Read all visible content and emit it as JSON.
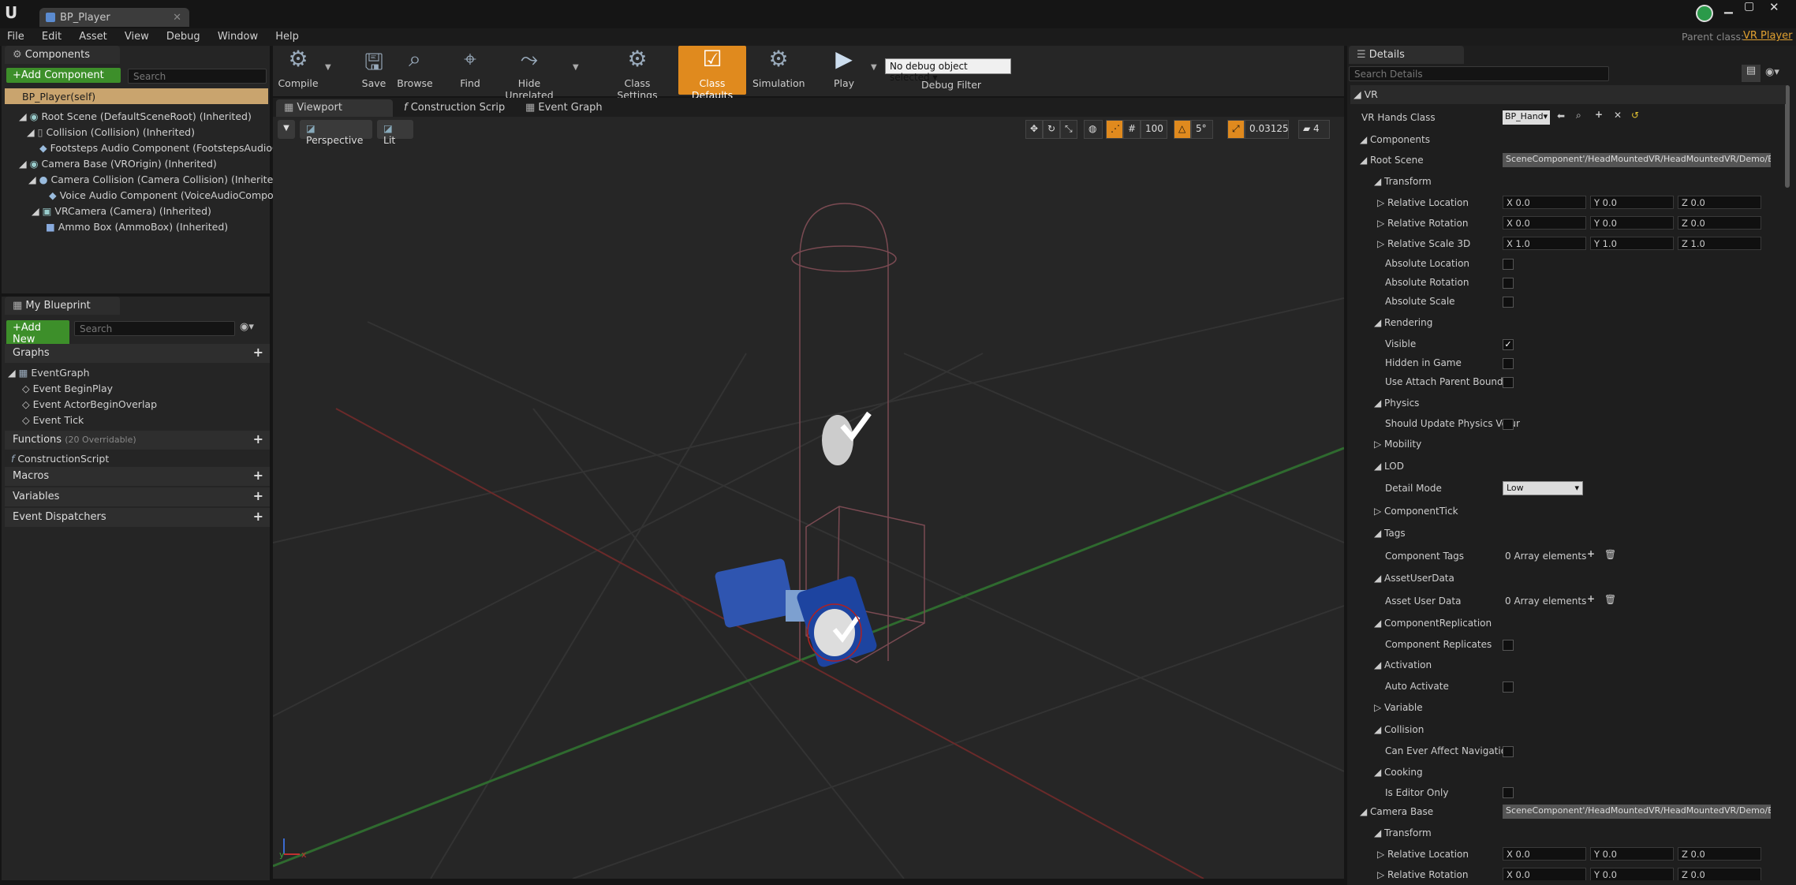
{
  "window": {
    "tab_title": "BP_Player",
    "parent_class_label": "Parent class:",
    "parent_class_value": "VR Player"
  },
  "menu": [
    "File",
    "Edit",
    "Asset",
    "View",
    "Debug",
    "Window",
    "Help"
  ],
  "components_panel": {
    "title": "Components",
    "add_button": "+Add Component",
    "search_placeholder": "Search",
    "self_label": "BP_Player(self)",
    "items": [
      "Root Scene (DefaultSceneRoot) (Inherited)",
      "Collision (Collision) (Inherited)",
      "Footsteps Audio Component (FootstepsAudioCom",
      "Camera Base (VROrigin) (Inherited)",
      "Camera Collision (Camera Collision) (Inherited)",
      "Voice Audio Component (VoiceAudioComponent",
      "VRCamera (Camera) (Inherited)",
      "Ammo Box (AmmoBox) (Inherited)"
    ]
  },
  "blueprint_panel": {
    "title": "My Blueprint",
    "add_button": "+Add New",
    "search_placeholder": "Search",
    "graphs_label": "Graphs",
    "event_graph": "EventGraph",
    "events": [
      "Event BeginPlay",
      "Event ActorBeginOverlap",
      "Event Tick"
    ],
    "functions_label": "Functions",
    "functions_count": "(20 Overridable)",
    "construction_script": "ConstructionScript",
    "macros_label": "Macros",
    "variables_label": "Variables",
    "dispatchers_label": "Event Dispatchers"
  },
  "toolbar": {
    "compile": "Compile",
    "save": "Save",
    "browse": "Browse",
    "find": "Find",
    "hide_unrelated": "Hide Unrelated",
    "class_settings": "Class Settings",
    "class_defaults": "Class Defaults",
    "simulation": "Simulation",
    "play": "Play",
    "debug_select": "No debug object selected",
    "debug_filter": "Debug Filter"
  },
  "viewport": {
    "tabs": [
      "Viewport",
      "Construction Scrip",
      "Event Graph"
    ],
    "perspective": "Perspective",
    "lit": "Lit",
    "grid_size": "100",
    "rot_snap": "5°",
    "scale_snap": "0.03125",
    "cam_speed": "4"
  },
  "details": {
    "title": "Details",
    "search_placeholder": "Search Details",
    "vr_category": "VR",
    "vr_hands_class_label": "VR Hands Class",
    "vr_hands_class_value": "BP_Hand",
    "components_label": "Components",
    "root_scene_label": "Root Scene",
    "root_scene_path": "SceneComponent'/HeadMountedVR/HeadMountedVR/Demo/Blu",
    "transform": "Transform",
    "relative_location": "Relative Location",
    "relative_rotation": "Relative Rotation",
    "relative_scale": "Relative Scale 3D",
    "loc": {
      "x": "X  0.0",
      "y": "Y  0.0",
      "z": "Z  0.0"
    },
    "rot": {
      "x": "X  0.0",
      "y": "Y  0.0",
      "z": "Z  0.0"
    },
    "scale": {
      "x": "X  1.0",
      "y": "Y  1.0",
      "z": "Z  1.0"
    },
    "absolute_location": "Absolute Location",
    "absolute_rotation": "Absolute Rotation",
    "absolute_scale": "Absolute Scale",
    "rendering": "Rendering",
    "visible": "Visible",
    "hidden_in_game": "Hidden in Game",
    "use_attach_parent_bound": "Use Attach Parent Bound",
    "physics": "Physics",
    "should_update_physics": "Should Update Physics Volur",
    "mobility": "Mobility",
    "lod": "LOD",
    "detail_mode": "Detail Mode",
    "detail_mode_value": "Low",
    "component_tick": "ComponentTick",
    "tags": "Tags",
    "component_tags": "Component Tags",
    "array_elements": "0 Array elements",
    "asset_user_data_cat": "AssetUserData",
    "asset_user_data": "Asset User Data",
    "component_replication": "ComponentReplication",
    "component_replicates": "Component Replicates",
    "activation": "Activation",
    "auto_activate": "Auto Activate",
    "variable": "Variable",
    "collision": "Collision",
    "can_affect_nav": "Can Ever Affect Navigation",
    "cooking": "Cooking",
    "is_editor_only": "Is Editor Only",
    "camera_base_label": "Camera Base",
    "camera_base_path": "SceneComponent'/HeadMountedVR/HeadMountedVR/Demo/Blu"
  },
  "colors": {
    "accent_orange": "#e08a1e",
    "add_green": "#3d8f2a"
  }
}
